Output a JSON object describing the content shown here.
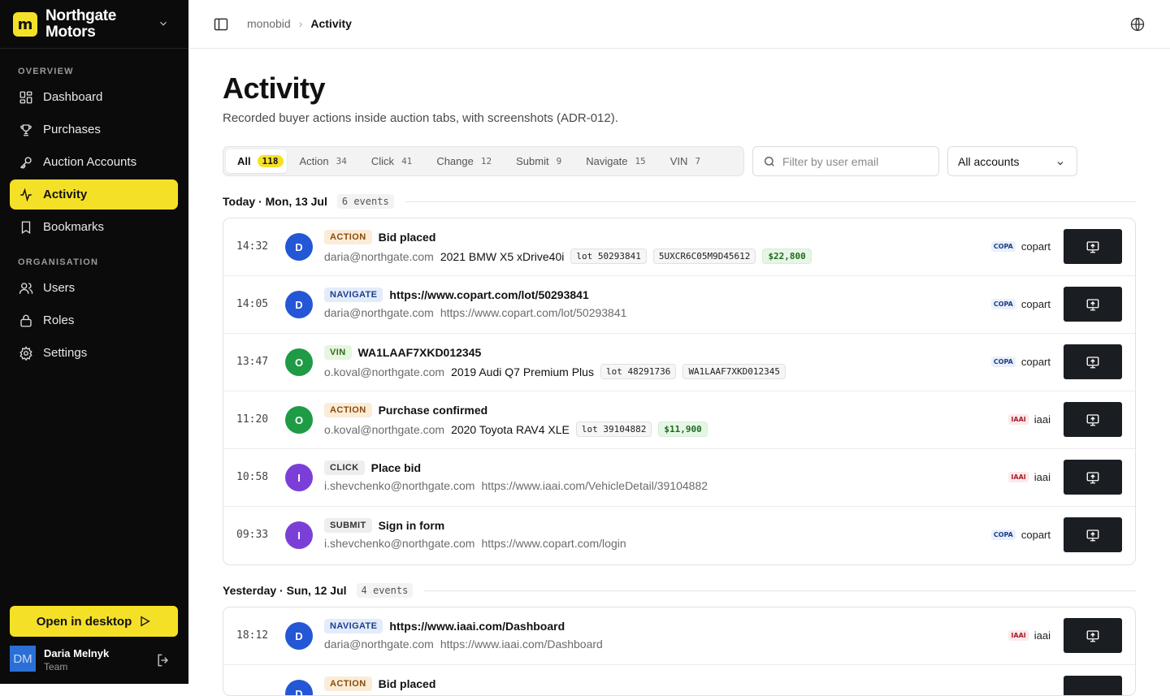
{
  "sidebar": {
    "brand_initial": "m",
    "brand_name": "Northgate Motors",
    "overview_label": "OVERVIEW",
    "organisation_label": "ORGANISATION",
    "items": [
      {
        "label": "Dashboard",
        "icon": "dashboard-icon"
      },
      {
        "label": "Purchases",
        "icon": "trophy-icon"
      },
      {
        "label": "Auction Accounts",
        "icon": "key-icon"
      },
      {
        "label": "Activity",
        "icon": "activity-icon",
        "active": true
      },
      {
        "label": "Bookmarks",
        "icon": "bookmark-icon"
      },
      {
        "label": "Users",
        "icon": "users-icon"
      },
      {
        "label": "Roles",
        "icon": "lock-icon"
      },
      {
        "label": "Settings",
        "icon": "gear-icon"
      }
    ],
    "open_desktop_label": "Open in desktop",
    "user": {
      "initials": "DM",
      "name": "Daria Melnyk",
      "role": "Team"
    }
  },
  "topbar": {
    "breadcrumb": [
      "monobid",
      "Activity"
    ]
  },
  "page": {
    "title": "Activity",
    "subtitle": "Recorded buyer actions inside auction tabs, with screenshots (ADR-012)."
  },
  "tabs": [
    {
      "label": "All",
      "count": "118",
      "active": true
    },
    {
      "label": "Action",
      "count": "34"
    },
    {
      "label": "Click",
      "count": "41"
    },
    {
      "label": "Change",
      "count": "12"
    },
    {
      "label": "Submit",
      "count": "9"
    },
    {
      "label": "Navigate",
      "count": "15"
    },
    {
      "label": "VIN",
      "count": "7"
    }
  ],
  "filter": {
    "placeholder": "Filter by user email"
  },
  "account_select": {
    "value": "All accounts"
  },
  "groups": [
    {
      "title": "Today · Mon, 13 Jul",
      "count": "6 events",
      "events": [
        {
          "time": "14:32",
          "initial": "D",
          "color": "#2457d6",
          "badge": "ACTION",
          "kind": "action",
          "title": "Bid placed",
          "email": "daria@northgate.com",
          "detail": "2021 BMW X5 xDrive40i",
          "chips": [
            "lot 50293841",
            "5UXCR6C05M9D45612"
          ],
          "price": "$22,800",
          "account_tag": "COPA",
          "account": "copart"
        },
        {
          "time": "14:05",
          "initial": "D",
          "color": "#2457d6",
          "badge": "NAVIGATE",
          "kind": "navigate",
          "title": "https://www.copart.com/lot/50293841",
          "email": "daria@northgate.com",
          "url": "https://www.copart.com/lot/50293841",
          "account_tag": "COPA",
          "account": "copart"
        },
        {
          "time": "13:47",
          "initial": "O",
          "color": "#1f9a45",
          "badge": "VIN",
          "kind": "vin",
          "title": "WA1LAAF7XKD012345",
          "email": "o.koval@northgate.com",
          "detail": "2019 Audi Q7 Premium Plus",
          "chips": [
            "lot 48291736",
            "WA1LAAF7XKD012345"
          ],
          "account_tag": "COPA",
          "account": "copart"
        },
        {
          "time": "11:20",
          "initial": "O",
          "color": "#1f9a45",
          "badge": "ACTION",
          "kind": "action",
          "title": "Purchase confirmed",
          "email": "o.koval@northgate.com",
          "detail": "2020 Toyota RAV4 XLE",
          "chips": [
            "lot 39104882"
          ],
          "price": "$11,900",
          "account_tag": "IAAI",
          "account": "iaai"
        },
        {
          "time": "10:58",
          "initial": "I",
          "color": "#7b3fd8",
          "badge": "CLICK",
          "kind": "click",
          "title": "Place bid",
          "email": "i.shevchenko@northgate.com",
          "url": "https://www.iaai.com/VehicleDetail/39104882",
          "account_tag": "IAAI",
          "account": "iaai"
        },
        {
          "time": "09:33",
          "initial": "I",
          "color": "#7b3fd8",
          "badge": "SUBMIT",
          "kind": "submit",
          "title": "Sign in form",
          "email": "i.shevchenko@northgate.com",
          "url": "https://www.copart.com/login",
          "account_tag": "COPA",
          "account": "copart"
        }
      ]
    },
    {
      "title": "Yesterday · Sun, 12 Jul",
      "count": "4 events",
      "events": [
        {
          "time": "18:12",
          "initial": "D",
          "color": "#2457d6",
          "badge": "NAVIGATE",
          "kind": "navigate",
          "title": "https://www.iaai.com/Dashboard",
          "email": "daria@northgate.com",
          "url": "https://www.iaai.com/Dashboard",
          "account_tag": "IAAI",
          "account": "iaai"
        },
        {
          "time": "",
          "initial": "D",
          "color": "#2457d6",
          "badge": "ACTION",
          "kind": "action",
          "title": "Bid placed",
          "email": "",
          "account_tag": "",
          "account": ""
        }
      ]
    }
  ]
}
